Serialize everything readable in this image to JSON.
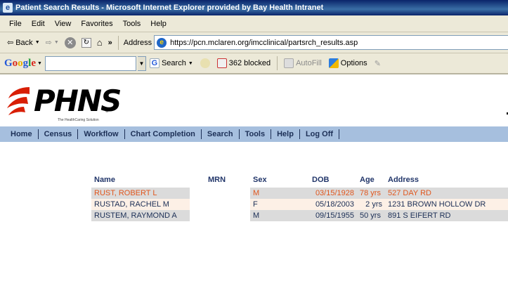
{
  "window": {
    "title": "Patient Search Results - Microsoft Internet Explorer provided by Bay Health Intranet"
  },
  "menubar": {
    "items": [
      "File",
      "Edit",
      "View",
      "Favorites",
      "Tools",
      "Help"
    ]
  },
  "toolbar": {
    "back_label": "Back",
    "more_label": "»",
    "address_label": "Address",
    "url": "https://pcn.mclaren.org/imcclinical/partsrch_results.asp"
  },
  "google_toolbar": {
    "logo": "Google",
    "search_value": "",
    "search_label": "Search",
    "blocked_label": "362 blocked",
    "autofill_label": "AutoFill",
    "options_label": "Options"
  },
  "brand": {
    "logo_text": "PHNS",
    "tagline": "The HealthCaring Solution",
    "reg_mark": "®"
  },
  "nav": {
    "items": [
      "Home",
      "Census",
      "Workflow",
      "Chart Completion",
      "Search",
      "Tools",
      "Help",
      "Log Off"
    ]
  },
  "results": {
    "columns": [
      "Name",
      "MRN",
      "Sex",
      "DOB",
      "Age",
      "Address"
    ],
    "rows": [
      {
        "name": "RUST, ROBERT L",
        "mrn": "",
        "sex": "M",
        "dob": "03/15/1928",
        "age": "78 yrs",
        "address": "527 DAY RD"
      },
      {
        "name": "RUSTAD, RACHEL M",
        "mrn": "",
        "sex": "F",
        "dob": "05/18/2003",
        "age": "2 yrs",
        "address": "1231 BROWN HOLLOW DR"
      },
      {
        "name": "RUSTEM, RAYMOND A",
        "mrn": "",
        "sex": "M",
        "dob": "09/15/1955",
        "age": "50 yrs",
        "address": "891 S EIFERT RD"
      }
    ]
  },
  "colors": {
    "nav_bar": "#a6bfde",
    "header_text": "#22366a",
    "selected_row_text": "#e0561d",
    "row_text": "#1c2f56"
  }
}
